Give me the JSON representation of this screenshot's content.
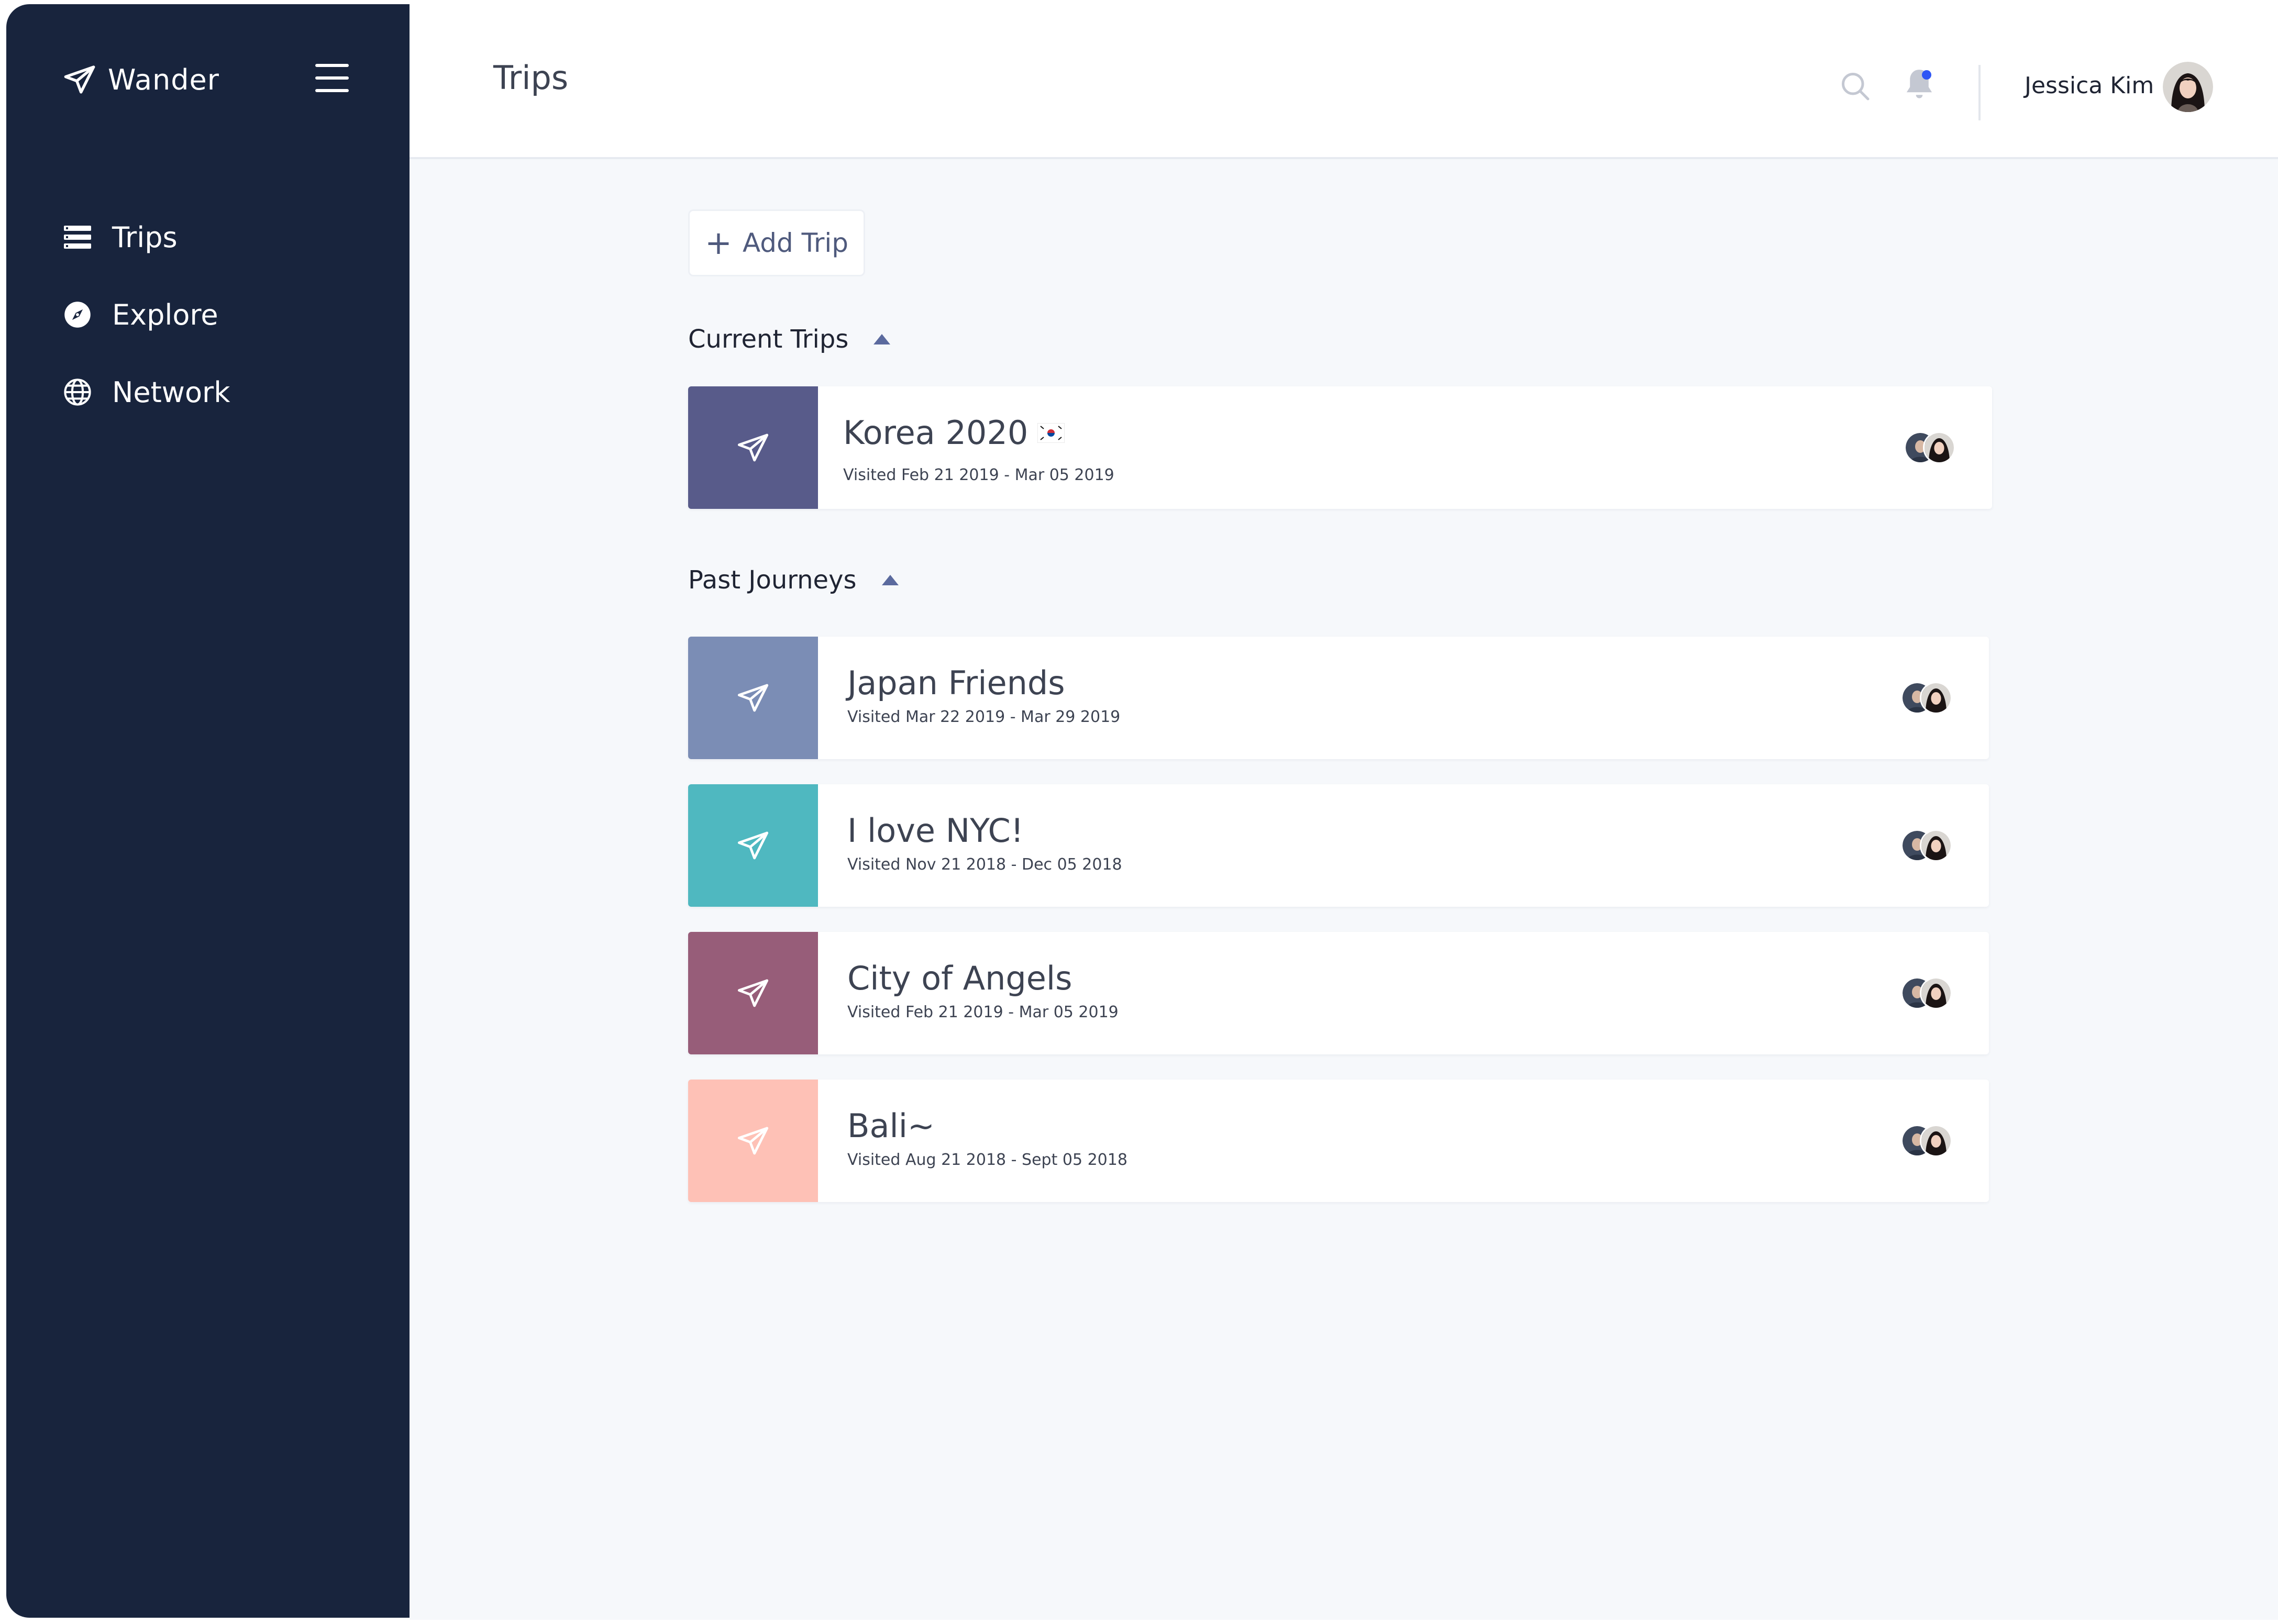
{
  "brand": {
    "name": "Wander"
  },
  "sidebar": {
    "items": [
      {
        "label": "Trips",
        "icon": "list-icon"
      },
      {
        "label": "Explore",
        "icon": "compass-icon"
      },
      {
        "label": "Network",
        "icon": "globe-icon"
      }
    ]
  },
  "header": {
    "title": "Trips",
    "user_name": "Jessica Kim"
  },
  "main": {
    "add_trip_label": "Add Trip",
    "current_section": "Current Trips",
    "past_section": "Past Journeys",
    "current_trips": [
      {
        "name": "Korea 2020",
        "dates": "Visited Feb 21 2019 - Mar 05 2019",
        "color": "#585b8a"
      }
    ],
    "past_trips": [
      {
        "name": "Japan Friends",
        "dates": "Visited Mar 22 2019 - Mar 29 2019",
        "color": "#7b8db5"
      },
      {
        "name": "I love NYC!",
        "dates": "Visited Nov 21 2018 - Dec 05 2018",
        "color": "#4fb8c0"
      },
      {
        "name": "City of Angels",
        "dates": "Visited Feb 21 2019 - Mar 05 2019",
        "color": "#975d79"
      },
      {
        "name": "Bali~",
        "dates": "Visited Aug 21 2018 - Sept 05 2018",
        "color": "#fec1b6"
      }
    ]
  },
  "colors": {
    "sidebar_bg": "#18243d",
    "accent": "#2f56f5",
    "main_bg": "#f6f8fb"
  }
}
